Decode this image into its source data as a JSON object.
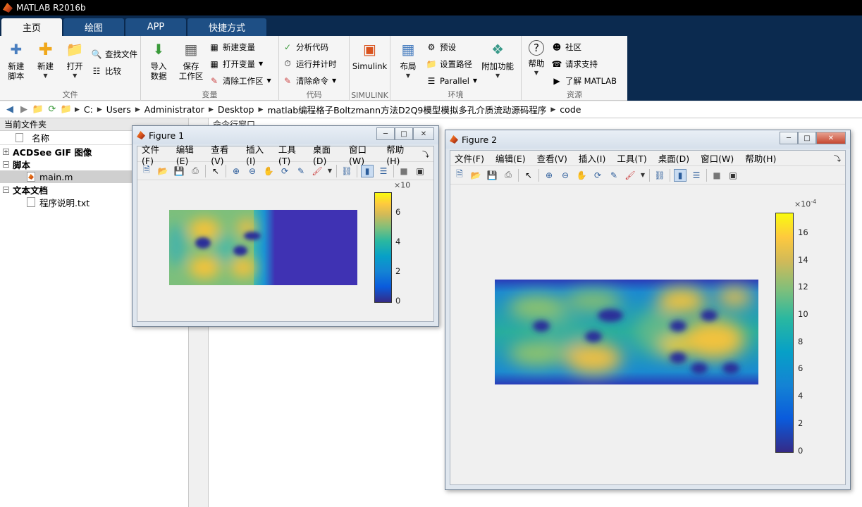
{
  "app": {
    "title": "MATLAB R2016b"
  },
  "tabs": [
    "主页",
    "绘图",
    "APP",
    "快捷方式"
  ],
  "ribbon": {
    "file": {
      "label": "文件",
      "new_script": [
        "新建",
        "脚本"
      ],
      "new": "新建",
      "open": "打开",
      "find_files": "查找文件",
      "compare": "比较"
    },
    "variable": {
      "label": "变量",
      "import": [
        "导入",
        "数据"
      ],
      "save": [
        "保存",
        "工作区"
      ],
      "new_var": "新建变量",
      "open_var": "打开变量",
      "clear_ws": "清除工作区"
    },
    "code": {
      "label": "代码",
      "analyze": "分析代码",
      "run_time": "运行并计时",
      "clear_cmd": "清除命令"
    },
    "simulink": {
      "label": "SIMULINK",
      "btn": "Simulink"
    },
    "env": {
      "label": "环境",
      "layout": "布局",
      "prefs": "预设",
      "set_path": "设置路径",
      "parallel": "Parallel",
      "addons": "附加功能"
    },
    "resources": {
      "label": "资源",
      "help": "帮助",
      "community": "社区",
      "support": "请求支持",
      "learn": "了解 MATLAB"
    }
  },
  "address": {
    "crumbs": [
      "C:",
      "Users",
      "Administrator",
      "Desktop",
      "matlab编程格子Boltzmann方法D2Q9模型模拟多孔介质流动源码程序",
      "code"
    ]
  },
  "current_folder": {
    "title": "当前文件夹",
    "col_name": "名称",
    "groups": [
      {
        "label": "ACDSee GIF 图像",
        "files": []
      },
      {
        "label": "脚本",
        "files": [
          "main.m"
        ]
      },
      {
        "label": "文本文档",
        "files": [
          "程序说明.txt"
        ]
      }
    ]
  },
  "command_window": {
    "title": "命令行窗口"
  },
  "figure_menu": [
    "文件(F)",
    "编辑(E)",
    "查看(V)",
    "插入(I)",
    "工具(T)",
    "桌面(D)",
    "窗口(W)",
    "帮助(H)"
  ],
  "figures": [
    {
      "title": "Figure 1",
      "colorbar": {
        "ticks": [
          "0",
          "2",
          "4",
          "6"
        ],
        "exponent_base": "×10",
        "exponent": ""
      }
    },
    {
      "title": "Figure 2",
      "colorbar": {
        "ticks": [
          "0",
          "2",
          "4",
          "6",
          "8",
          "10",
          "12",
          "14",
          "16"
        ],
        "exponent_base": "×10",
        "exponent": "-4"
      }
    }
  ],
  "colors": {
    "tab_bar": "#0b2a4f",
    "parula_low": "#352a87",
    "parula_high": "#f9fb0e"
  }
}
